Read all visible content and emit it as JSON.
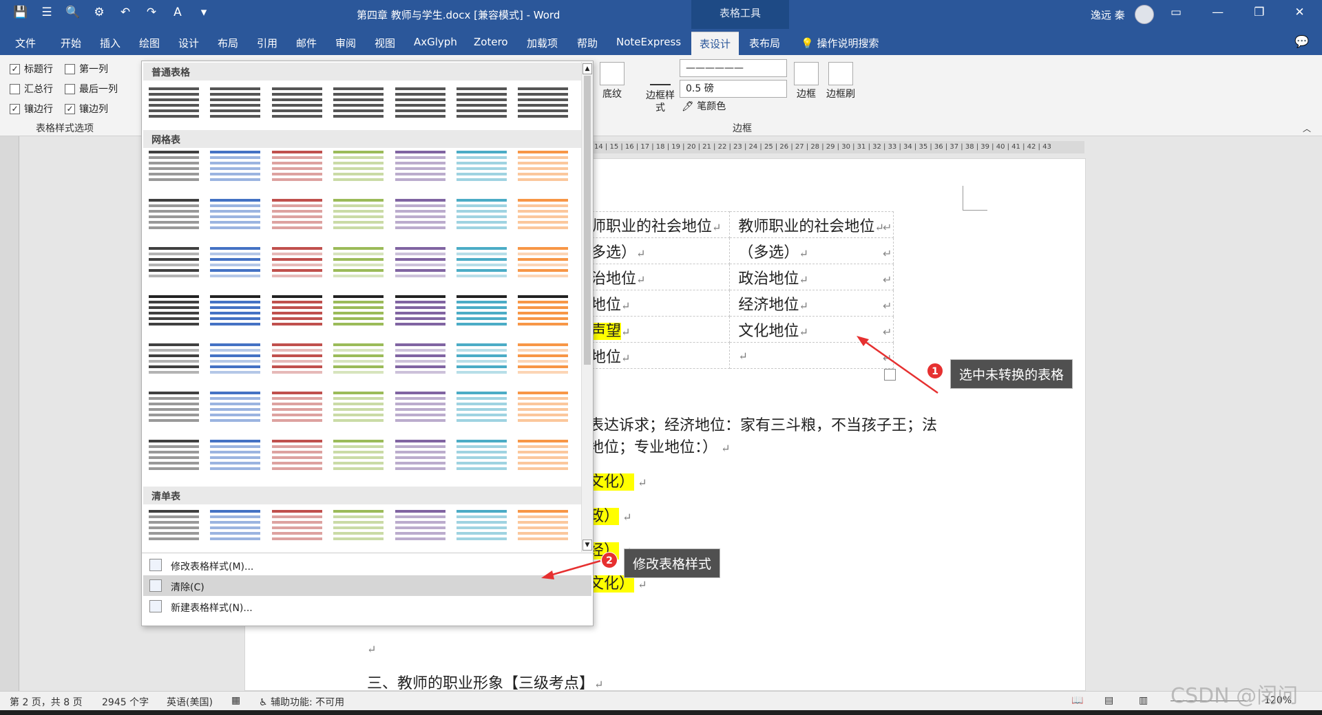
{
  "window": {
    "title": "第四章 教师与学生.docx [兼容模式] - Word",
    "context_tab": "表格工具",
    "user": "逸远 秦"
  },
  "tabs": [
    "文件",
    "开始",
    "插入",
    "绘图",
    "设计",
    "布局",
    "引用",
    "邮件",
    "审阅",
    "视图",
    "AxGlyph",
    "Zotero",
    "加载项",
    "帮助",
    "NoteExpress",
    "表设计",
    "表布局"
  ],
  "tell_me": "操作说明搜索",
  "ribbon": {
    "options": {
      "header_row": "标题行",
      "first_col": "第一列",
      "total_row": "汇总行",
      "last_col": "最后一列",
      "banded_rows": "镶边行",
      "banded_cols": "镶边列",
      "group": "表格样式选项"
    },
    "shading": "底纹",
    "border_styles": "边框样式",
    "pen_weight": "0.5 磅",
    "pen_color": "笔颜色",
    "borders": "边框",
    "border_painter": "边框刷",
    "borders_group": "边框"
  },
  "gallery": {
    "sections": [
      "普通表格",
      "网格表",
      "清单表"
    ],
    "menu": {
      "modify": "修改表格样式(M)...",
      "clear": "清除(C)",
      "new": "新建表格样式(N)..."
    }
  },
  "palette": [
    "#404040",
    "#4472c4",
    "#c0504d",
    "#9bbb59",
    "#8064a2",
    "#4bacc6",
    "#f79646"
  ],
  "document": {
    "table": [
      [
        "师职业的社会地位",
        "教师职业的社会地位"
      ],
      [
        "多选）",
        "（多选）"
      ],
      [
        "治地位",
        "政治地位"
      ],
      [
        "地位",
        "经济地位"
      ],
      [
        "声望",
        "文化地位"
      ],
      [
        "地位",
        ""
      ]
    ],
    "para1": "表达诉求；经济地位：家有三斗粮，不当孩子王；法",
    "para2": "地位；专业地位：）",
    "items": [
      "文化）",
      "政）",
      "经）",
      "文化）"
    ],
    "heading": "三、教师的职业形象【三级考点】"
  },
  "callouts": [
    {
      "num": "1",
      "text": "选中未转换的表格"
    },
    {
      "num": "2",
      "text": "修改表格样式"
    }
  ],
  "status": {
    "page": "第 2 页，共 8 页",
    "words": "2945 个字",
    "lang": "英语(美国)",
    "access": "辅助功能: 不可用",
    "zoom": "120%"
  },
  "watermark": "CSDN @闵问"
}
